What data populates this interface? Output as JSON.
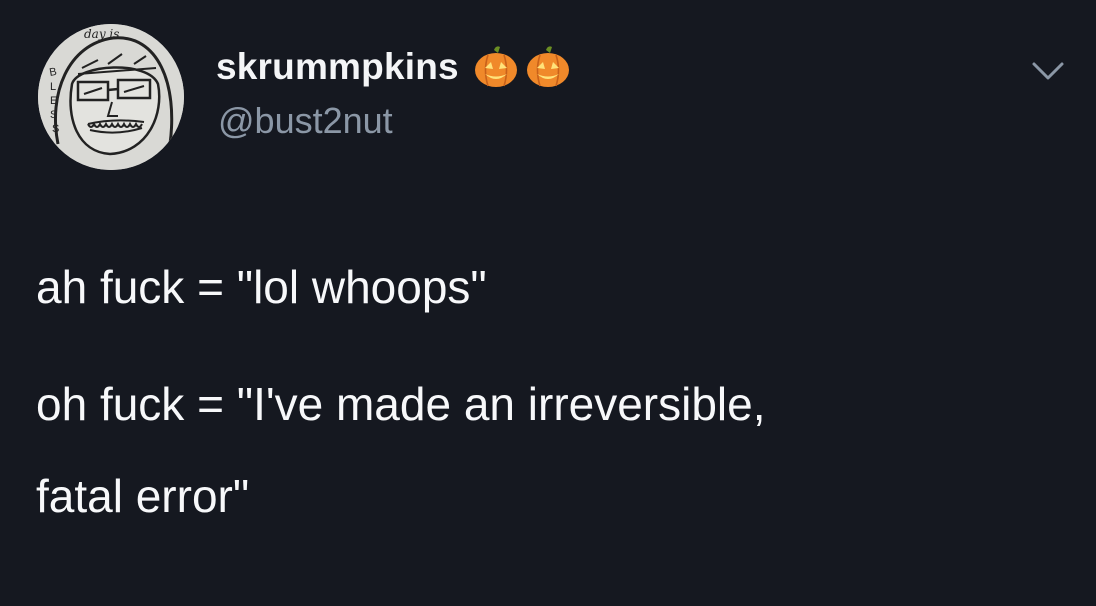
{
  "user": {
    "display_name": "skrummpkins",
    "handle": "@bust2nut",
    "name_emojis": [
      "jack-o-lantern",
      "jack-o-lantern"
    ],
    "avatar_icon": "hand-drawn-face-avatar",
    "avatar_lettering": [
      "day is",
      "BLESS"
    ]
  },
  "tweet": {
    "lines": [
      "ah fuck = \"lol whoops\"",
      "oh fuck = \"I've made an irreversible,",
      "fatal error\""
    ]
  },
  "menu_icon": "chevron-down-icon",
  "colors": {
    "background": "#151820",
    "text": "#f4f5f7",
    "secondary_text": "#8b97a6",
    "pumpkin": "#f0892a"
  }
}
